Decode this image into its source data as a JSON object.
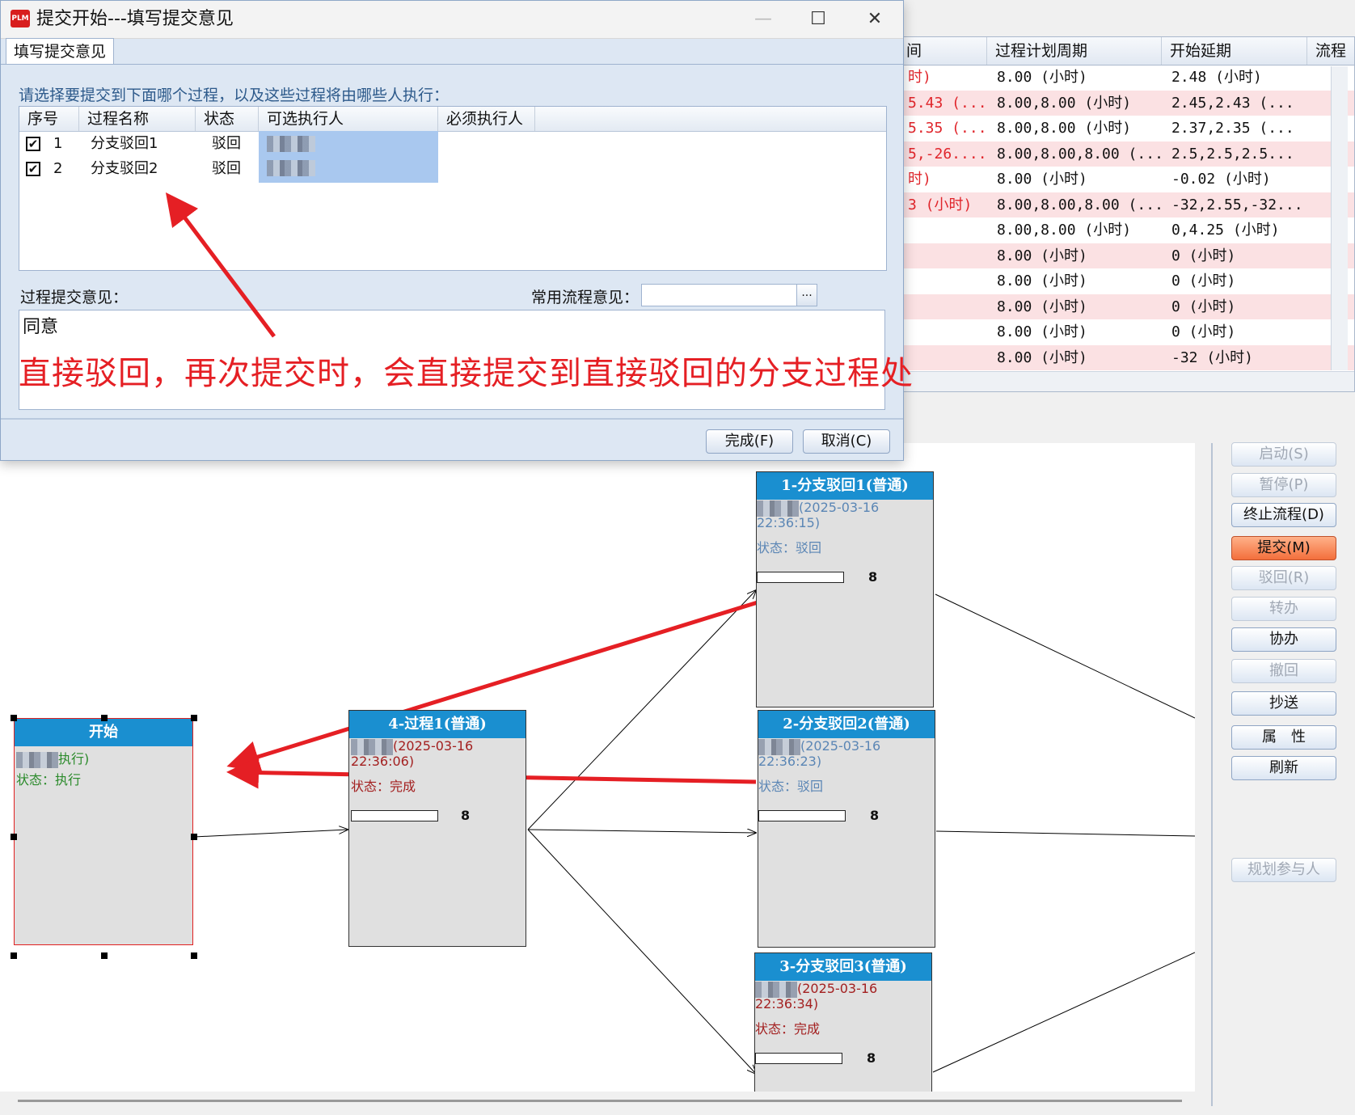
{
  "window": {
    "title": "提交开始---填写提交意见",
    "icon_text": "PLM",
    "minimize": "—",
    "maximize": "☐",
    "close": "✕"
  },
  "dialog": {
    "tab_label": "填写提交意见",
    "prompt": "请选择要提交到下面哪个过程，以及这些过程将由哪些人执行：",
    "columns": [
      "序号",
      "过程名称",
      "状态",
      "可选执行人",
      "必须执行人"
    ],
    "rows": [
      {
        "checked": "✔",
        "index": "1",
        "name": "分支驳回1",
        "status": "驳回"
      },
      {
        "checked": "✔",
        "index": "2",
        "name": "分支驳回2",
        "status": "驳回"
      }
    ],
    "comment_label": "过程提交意见：",
    "common_opinion_label": "常用流程意见：",
    "common_opinion_value": "",
    "combo_button": "...",
    "comment_value": "同意",
    "annotation": "直接驳回，再次提交时，会直接提交到直接驳回的分支过程处",
    "finish_button": "完成(F)",
    "cancel_button": "取消(C)"
  },
  "bg_table": {
    "columns": [
      "间",
      "过程计划周期",
      "开始延期",
      "流程"
    ],
    "rows": [
      {
        "c0": "时)",
        "c1": "8.00 (小时)",
        "c2": "2.48 (小时)",
        "pink": false
      },
      {
        "c0": "5.43 (...",
        "c1": "8.00,8.00 (小时)",
        "c2": "2.45,2.43 (...",
        "pink": true
      },
      {
        "c0": "5.35 (...",
        "c1": "8.00,8.00 (小时)",
        "c2": "2.37,2.35 (...",
        "pink": false
      },
      {
        "c0": "5,-26....",
        "c1": "8.00,8.00,8.00 (...",
        "c2": "2.5,2.5,2.5...",
        "pink": true
      },
      {
        "c0": "时)",
        "c1": "8.00 (小时)",
        "c2": "-0.02 (小时)",
        "pink": false
      },
      {
        "c0": "3 (小时)",
        "c1": "8.00,8.00,8.00 (...",
        "c2": "-32,2.55,-32...",
        "pink": true
      },
      {
        "c0": "",
        "c1": "8.00,8.00 (小时)",
        "c2": "0,4.25 (小时)",
        "pink": false
      },
      {
        "c0": "",
        "c1": "8.00 (小时)",
        "c2": "0 (小时)",
        "pink": true
      },
      {
        "c0": "",
        "c1": "8.00 (小时)",
        "c2": "0 (小时)",
        "pink": false
      },
      {
        "c0": "",
        "c1": "8.00 (小时)",
        "c2": "0 (小时)",
        "pink": true
      },
      {
        "c0": "",
        "c1": "8.00 (小时)",
        "c2": "0 (小时)",
        "pink": false
      },
      {
        "c0": "",
        "c1": "8.00 (小时)",
        "c2": "-32 (小时)",
        "pink": true
      }
    ]
  },
  "side_buttons": {
    "start": "启动(S)",
    "pause": "暂停(P)",
    "terminate": "终止流程(D)",
    "submit": "提交(M)",
    "reject": "驳回(R)",
    "transfer": "转办",
    "assist": "协办",
    "withdraw": "撤回",
    "cc": "抄送",
    "properties": "属　性",
    "refresh": "刷新",
    "plan_participants": "规划参与人"
  },
  "diagram": {
    "start": {
      "title": "开始",
      "line1": "执行)",
      "line2": "状态：执行"
    },
    "p1": {
      "title": "4-过程1(普通)",
      "date": "(2025-03-16",
      "time": "22:36:06)",
      "state": "状态：完成",
      "hours": "8"
    },
    "b1": {
      "title": "1-分支驳回1(普通)",
      "date": "(2025-03-16",
      "time": "22:36:15)",
      "state": "状态：驳回",
      "hours": "8"
    },
    "b2": {
      "title": "2-分支驳回2(普通)",
      "date": "(2025-03-16",
      "time": "22:36:23)",
      "state": "状态：驳回",
      "hours": "8"
    },
    "b3": {
      "title": "3-分支驳回3(普通)",
      "date": "(2025-03-16",
      "time": "22:36:34)",
      "state": "状态：完成",
      "hours": "8"
    }
  },
  "colors": {
    "title_bar_blue": "#1a8fd0",
    "annotation_red": "#e51f24",
    "active_button": "#f36f3c",
    "reject_state": "#5b86b5",
    "done_state": "#a32020",
    "exec_state": "#2a8a2a"
  }
}
